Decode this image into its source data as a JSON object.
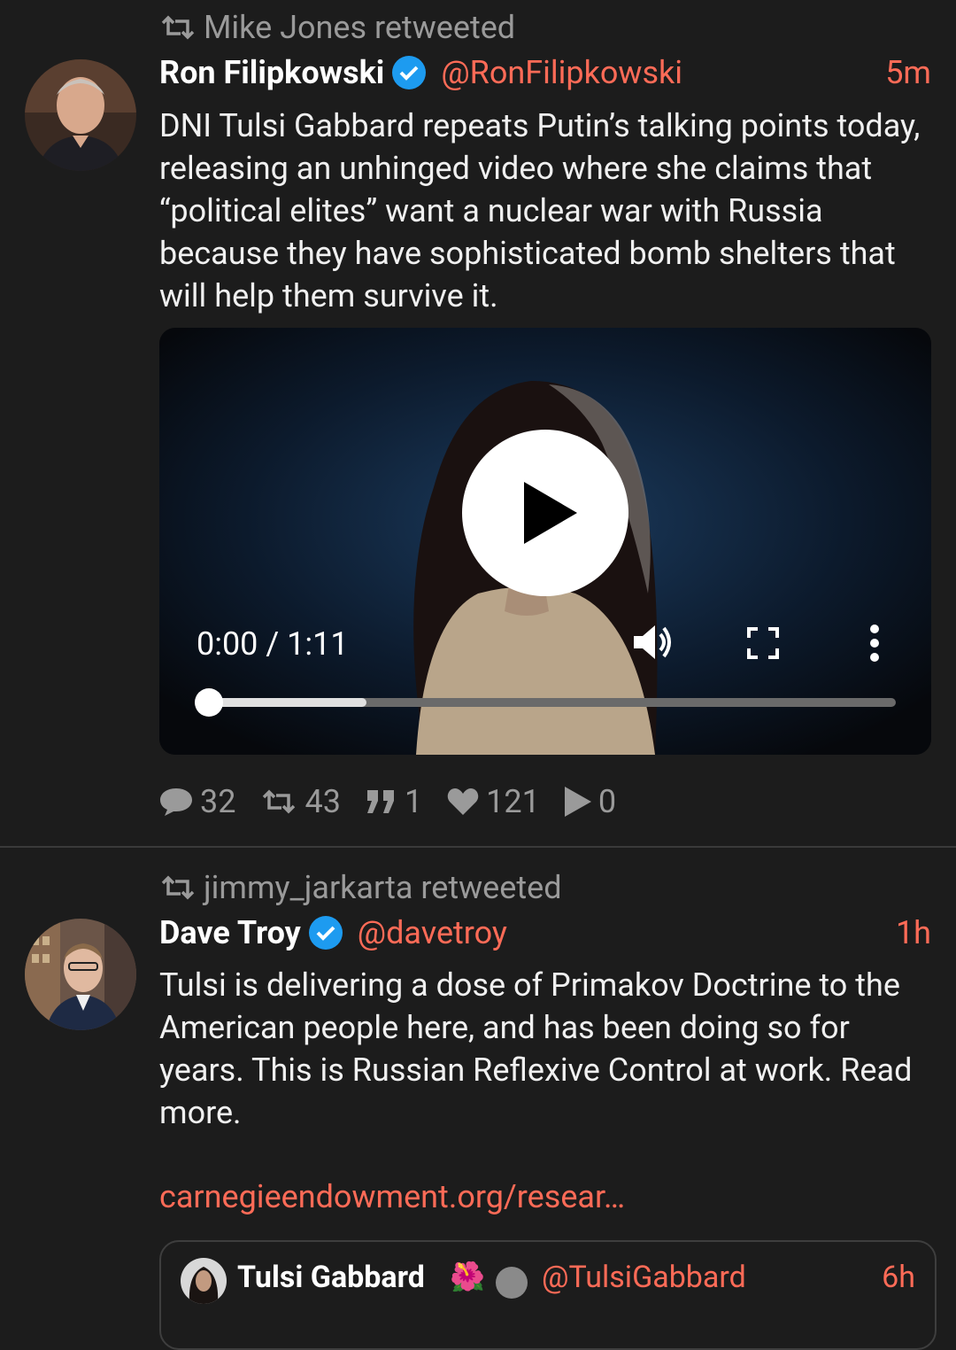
{
  "tweets": [
    {
      "retweeted_by": "Mike Jones retweeted",
      "name": "Ron Filipkowski",
      "handle": "@RonFilipkowski",
      "time": "5m",
      "text": "DNI Tulsi Gabbard repeats Putin’s talking points today, releasing an unhinged video where she claims that “political elites” want a nuclear war with Russia because they have sophisticated bomb shelters that will help them survive it.",
      "video": {
        "time_label": "0:00 / 1:11",
        "buffered_fraction": 0.23,
        "played_fraction": 0.0
      },
      "stats": {
        "replies": "32",
        "retweets": "43",
        "quotes": "1",
        "likes": "121",
        "plays": "0"
      }
    },
    {
      "retweeted_by": "jimmy_jarkarta retweeted",
      "name": "Dave Troy",
      "handle": "@davetroy",
      "time": "1h",
      "text": "Tulsi is delivering a dose of Primakov Doctrine to the American people here, and has been doing so for years. This is Russian Reflexive Control at work. Read more.",
      "link": "carnegieendowment.org/resear…",
      "quote": {
        "name": "Tulsi Gabbard",
        "emoji": "🌺",
        "handle": "@TulsiGabbard",
        "time": "6h"
      }
    }
  ],
  "colors": {
    "background": "#1c1c1c",
    "accent": "#ff6b57",
    "verified": "#1d9bf0",
    "muted": "#9a9a9a"
  },
  "icons": [
    "retweet-icon",
    "verified-icon",
    "play-icon",
    "volume-icon",
    "fullscreen-icon",
    "more-vert-icon",
    "reply-icon",
    "quote-icon",
    "like-icon",
    "views-icon"
  ]
}
